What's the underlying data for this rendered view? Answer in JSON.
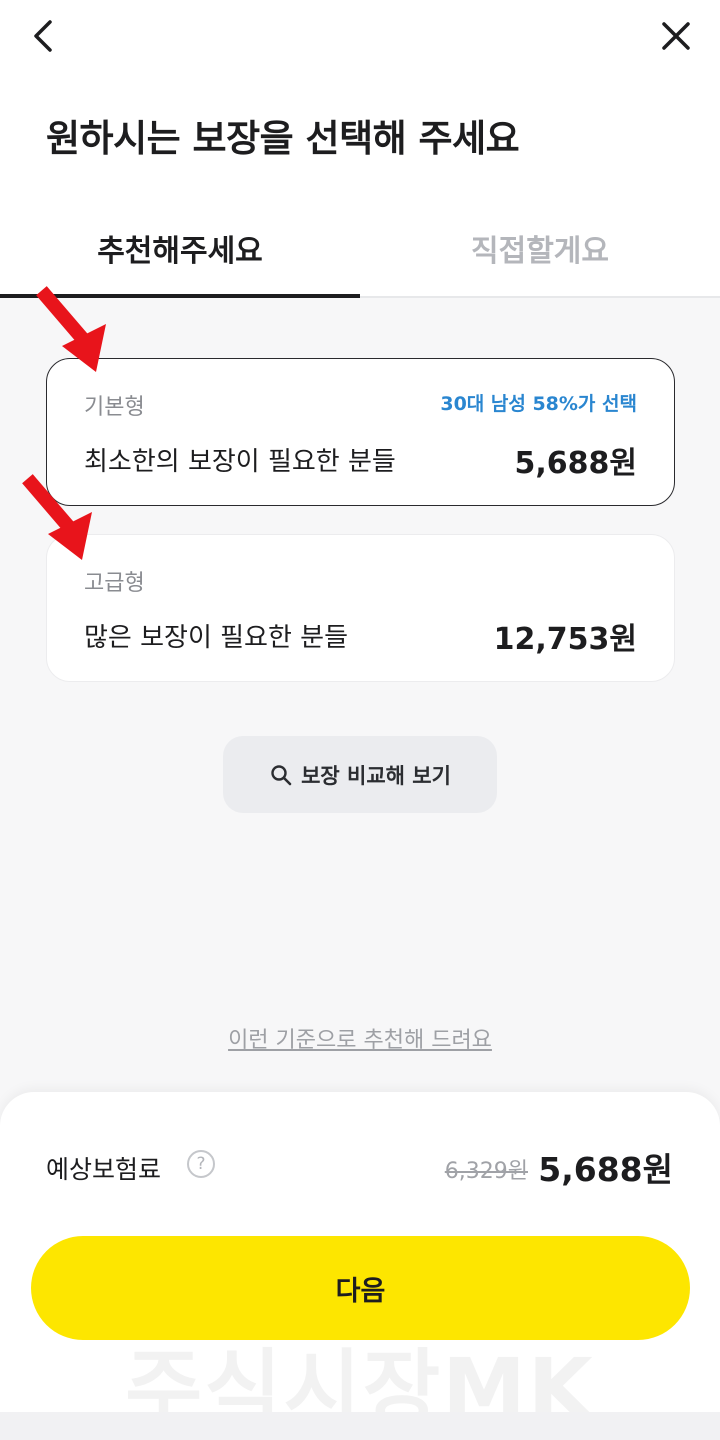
{
  "header": {
    "back_icon": "chevron-left-icon",
    "close_icon": "close-icon",
    "title": "원하시는 보장을 선택해 주세요"
  },
  "tabs": [
    {
      "label": "추천해주세요",
      "active": true
    },
    {
      "label": "직접할게요",
      "active": false
    }
  ],
  "plans": [
    {
      "type": "기본형",
      "badge": "30대 남성 58%가 선택",
      "description": "최소한의 보장이 필요한 분들",
      "price": "5,688원",
      "selected": true
    },
    {
      "type": "고급형",
      "description": "많은 보장이 필요한 분들",
      "price": "12,753원",
      "selected": false
    }
  ],
  "compare_button": {
    "label": "보장 비교해 보기",
    "icon": "search-icon"
  },
  "criteria_link": "이런 기준으로 추천해 드려요",
  "bottom_sheet": {
    "premium_label": "예상보험료",
    "help_icon": "?",
    "original_price": "6,329원",
    "final_price": "5,688원",
    "next_button": "다음"
  },
  "watermark": "주식시장MK",
  "colors": {
    "accent_yellow": "#fde600",
    "badge_blue": "#2a86d0",
    "annotation_red": "#e8141b"
  }
}
